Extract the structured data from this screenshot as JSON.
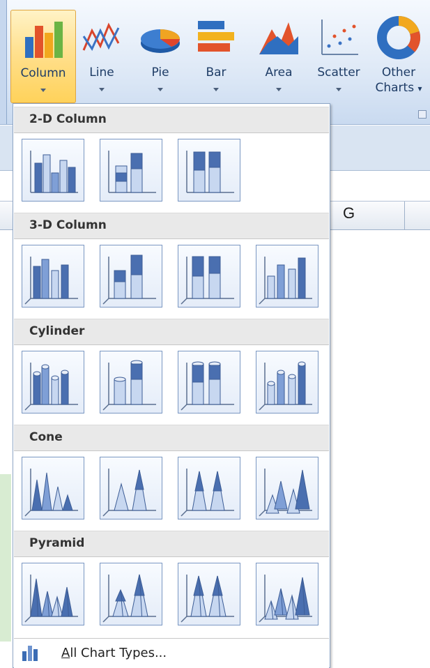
{
  "ribbon": {
    "buttons": [
      {
        "label": "Column",
        "icon": "column-chart-icon",
        "selected": true
      },
      {
        "label": "Line",
        "icon": "line-chart-icon"
      },
      {
        "label": "Pie",
        "icon": "pie-chart-icon"
      },
      {
        "label": "Bar",
        "icon": "bar-chart-icon"
      },
      {
        "label": "Area",
        "icon": "area-chart-icon"
      },
      {
        "label": "Scatter",
        "icon": "scatter-chart-icon"
      },
      {
        "label": "Other",
        "label2": "Charts",
        "icon": "doughnut-chart-icon"
      }
    ]
  },
  "sheet": {
    "column_g": "G"
  },
  "gallery": {
    "sections": [
      {
        "title": "2-D Column",
        "items": [
          "clustered-column",
          "stacked-column",
          "100-stacked-column"
        ]
      },
      {
        "title": "3-D Column",
        "items": [
          "3d-clustered-column",
          "3d-stacked-column",
          "3d-100-stacked-column",
          "3d-column"
        ]
      },
      {
        "title": "Cylinder",
        "items": [
          "clustered-cylinder",
          "stacked-cylinder",
          "100-stacked-cylinder",
          "3d-cylinder"
        ]
      },
      {
        "title": "Cone",
        "items": [
          "clustered-cone",
          "stacked-cone",
          "100-stacked-cone",
          "3d-cone"
        ]
      },
      {
        "title": "Pyramid",
        "items": [
          "clustered-pyramid",
          "stacked-pyramid",
          "100-stacked-pyramid",
          "3d-pyramid"
        ]
      }
    ],
    "footer": {
      "accel": "A",
      "rest": "ll Chart Types...",
      "icon": "all-chart-types-icon"
    }
  },
  "colors": {
    "accent": "#4a6fb0",
    "selected_bg": "#ffd25a",
    "section_bg": "#e9e9e9"
  }
}
